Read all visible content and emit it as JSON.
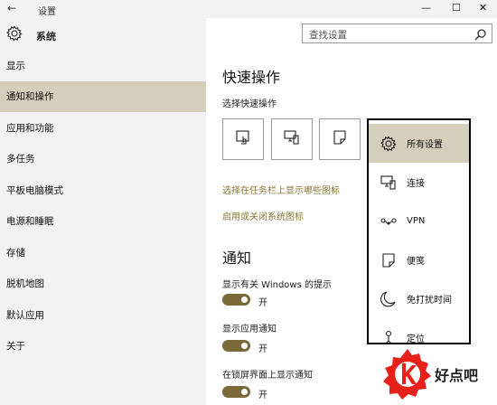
{
  "window": {
    "back_glyph": "←",
    "title": "设置",
    "minimize": "—",
    "maximize": "☐",
    "close": "✕"
  },
  "header": {
    "icon": "gear-icon",
    "label": "系统"
  },
  "search": {
    "placeholder": "查找设置",
    "icon": "search-icon"
  },
  "sidebar": {
    "items": [
      {
        "label": "显示",
        "selected": false
      },
      {
        "label": "通知和操作",
        "selected": true
      },
      {
        "label": "应用和功能",
        "selected": false
      },
      {
        "label": "多任务",
        "selected": false
      },
      {
        "label": "平板电脑模式",
        "selected": false
      },
      {
        "label": "电源和睡眠",
        "selected": false
      },
      {
        "label": "存储",
        "selected": false
      },
      {
        "label": "脱机地图",
        "selected": false
      },
      {
        "label": "默认应用",
        "selected": false
      },
      {
        "label": "关于",
        "selected": false
      }
    ],
    "selected_color": "#d5cebd"
  },
  "main": {
    "quick_actions_title": "快速操作",
    "quick_actions_sub": "选择快速操作",
    "tiles": [
      {
        "icon": "tablet-mode-icon"
      },
      {
        "icon": "connect-icon"
      },
      {
        "icon": "note-icon"
      }
    ],
    "link_taskbar": "选择在任务栏上显示哪些图标",
    "link_system_icons": "启用或关闭系统图标",
    "notifications_title": "通知",
    "options": [
      {
        "label": "显示有关 Windows 的提示",
        "state": "开"
      },
      {
        "label": "显示应用通知",
        "state": "开"
      },
      {
        "label": "在锁屏界面上显示通知",
        "state": "开"
      }
    ],
    "link_color": "#8a7638",
    "toggle_color": "#7a6a3a"
  },
  "popup": {
    "items": [
      {
        "label": "所有设置",
        "icon": "gear-icon",
        "selected": true
      },
      {
        "label": "连接",
        "icon": "connect-icon",
        "selected": false
      },
      {
        "label": "VPN",
        "icon": "vpn-icon",
        "selected": false
      },
      {
        "label": "便笺",
        "icon": "note-icon",
        "selected": false
      },
      {
        "label": "免打扰时间",
        "icon": "moon-icon",
        "selected": false
      },
      {
        "label": "定位",
        "icon": "location-icon",
        "selected": false
      }
    ]
  },
  "watermark": {
    "text": "好点吧",
    "logo_color": "#e8201a"
  }
}
